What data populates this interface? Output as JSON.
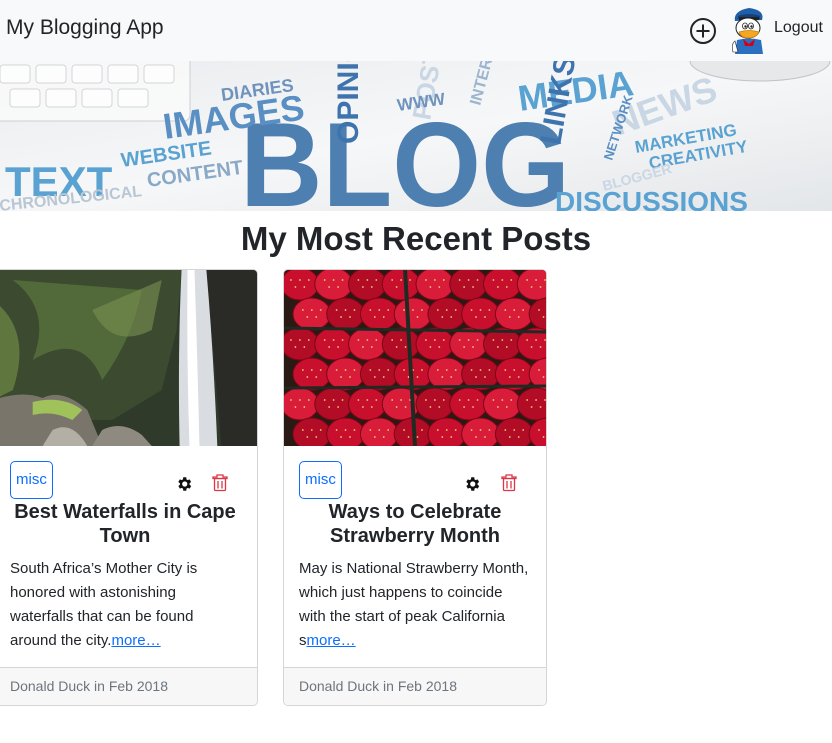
{
  "navbar": {
    "brand": "My Blogging App",
    "logout_label": "Logout",
    "add_icon": "plus-circle-icon",
    "avatar_icon": "donald-duck-avatar"
  },
  "hero": {
    "words": {
      "blog": "BLOG",
      "text": "TEXT",
      "images": "IMAGES",
      "media": "MEDIA",
      "website": "WEBSITE",
      "content": "CONTENT",
      "diaries": "DIARIES",
      "opinion": "OPINION",
      "links": "LINKS",
      "news": "NEWS",
      "marketing": "MARKETING",
      "creativity": "CREATIVITY",
      "network": "NETWORK",
      "blogger": "BLOGGER",
      "interact": "INTERACT",
      "post": "POST",
      "www": "WWW",
      "chronological": "CHRONOLOGICAL",
      "discussions": "DISCUSSIONS"
    }
  },
  "main": {
    "title": "My Most Recent Posts"
  },
  "posts": [
    {
      "category": "misc",
      "title": "Best Waterfalls in Cape Town",
      "excerpt": "South Africa’s Mother City is honored with astonishing waterfalls that can be found around the city.",
      "more": "more…",
      "footer": "Donald Duck in Feb 2018",
      "image": "waterfall-photo"
    },
    {
      "category": "misc",
      "title": "Ways to Celebrate Strawberry Month",
      "excerpt": "May is National Strawberry Month, which just happens to coincide with the start of peak California s",
      "more": "more…",
      "footer": "Donald Duck in Feb 2018",
      "image": "strawberries-photo"
    }
  ],
  "colors": {
    "primary": "#0d6efd",
    "danger": "#dc3545",
    "navbar_bg": "#f8f9fa",
    "footer_bg": "#f7f7f7"
  }
}
